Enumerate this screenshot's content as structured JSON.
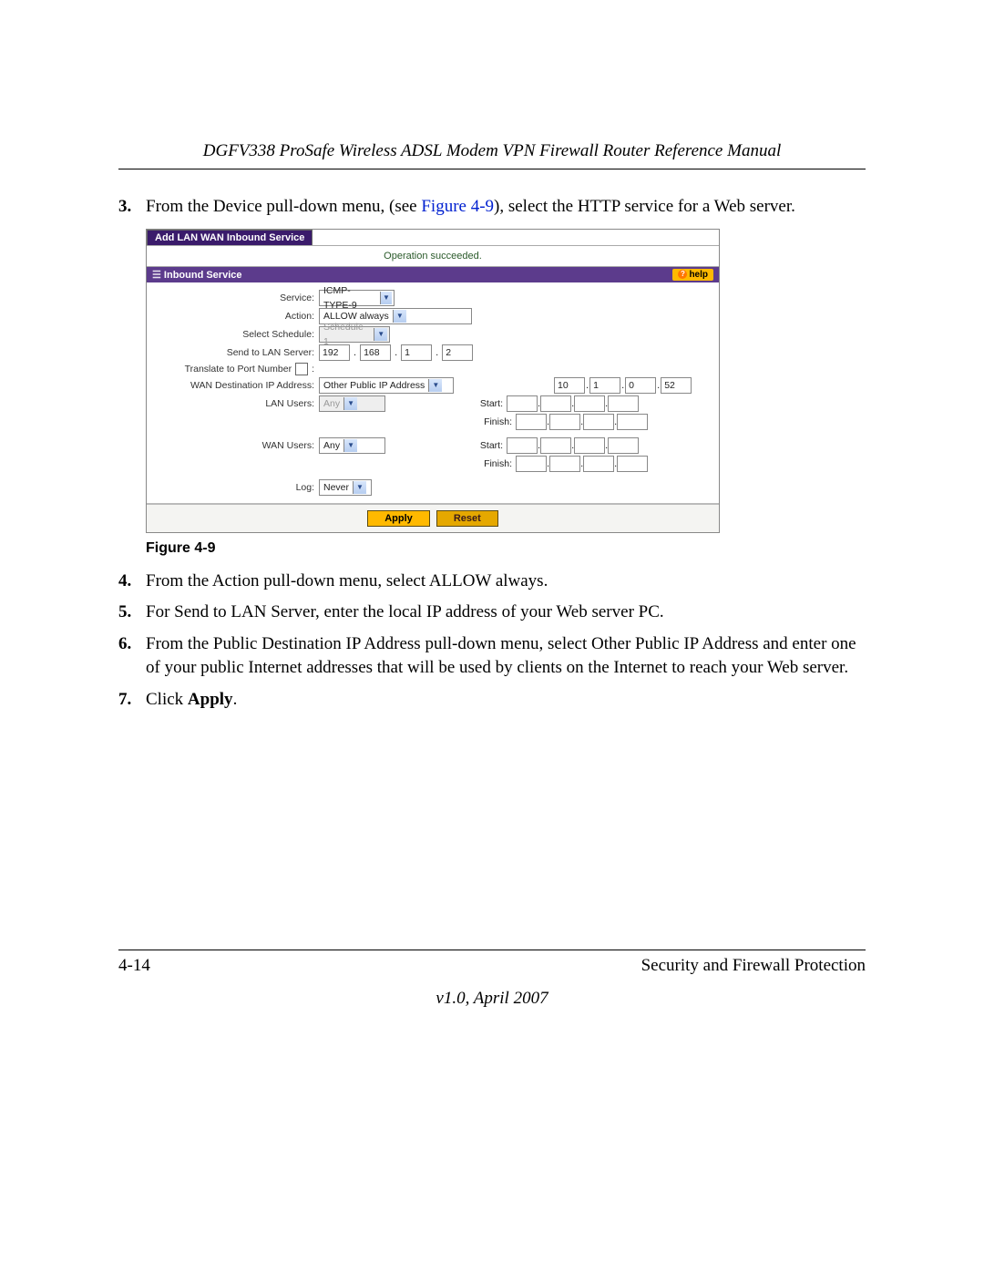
{
  "header": {
    "title": "DGFV338 ProSafe Wireless ADSL Modem VPN Firewall Router Reference Manual"
  },
  "steps": {
    "s3": {
      "num": "3.",
      "pre": "From the Device pull-down menu, (see ",
      "figref": "Figure 4-9",
      "post": "), select the HTTP service for a Web server."
    },
    "s4": {
      "num": "4.",
      "text": "From the Action pull-down menu, select ALLOW always."
    },
    "s5": {
      "num": "5.",
      "text": "For Send to LAN Server, enter the local IP address of your Web server PC."
    },
    "s6": {
      "num": "6.",
      "text": "From the Public Destination IP Address pull-down menu, select Other Public IP Address and enter one of your public Internet addresses that will be used by clients on the Internet to reach your Web server."
    },
    "s7": {
      "num": "7.",
      "pre": "Click ",
      "bold": "Apply",
      "post": "."
    }
  },
  "figure": {
    "caption": "Figure 4-9",
    "tab": "Add LAN WAN Inbound Service",
    "op_msg": "Operation succeeded.",
    "section": "Inbound Service",
    "help": "help",
    "labels": {
      "service": "Service:",
      "action": "Action:",
      "schedule": "Select Schedule:",
      "sendto": "Send to LAN Server:",
      "translate": "Translate to Port Number",
      "wanip": "WAN Destination IP Address:",
      "lanusers": "LAN Users:",
      "wanusers": "WAN Users:",
      "log": "Log:",
      "start": "Start:",
      "finish": "Finish:"
    },
    "values": {
      "service": "ICMP-TYPE-9",
      "action": "ALLOW always",
      "schedule": "Schedule 1",
      "send_ip": [
        "192",
        "168",
        "1",
        "2"
      ],
      "translate_colon": ":",
      "wanip_sel": "Other Public IP Address",
      "wanip_ip": [
        "10",
        "1",
        "0",
        "52"
      ],
      "lanusers": "Any",
      "wanusers": "Any",
      "log": "Never"
    },
    "buttons": {
      "apply": "Apply",
      "reset": "Reset"
    }
  },
  "footer": {
    "page": "4-14",
    "section": "Security and Firewall Protection",
    "version": "v1.0, April 2007"
  }
}
